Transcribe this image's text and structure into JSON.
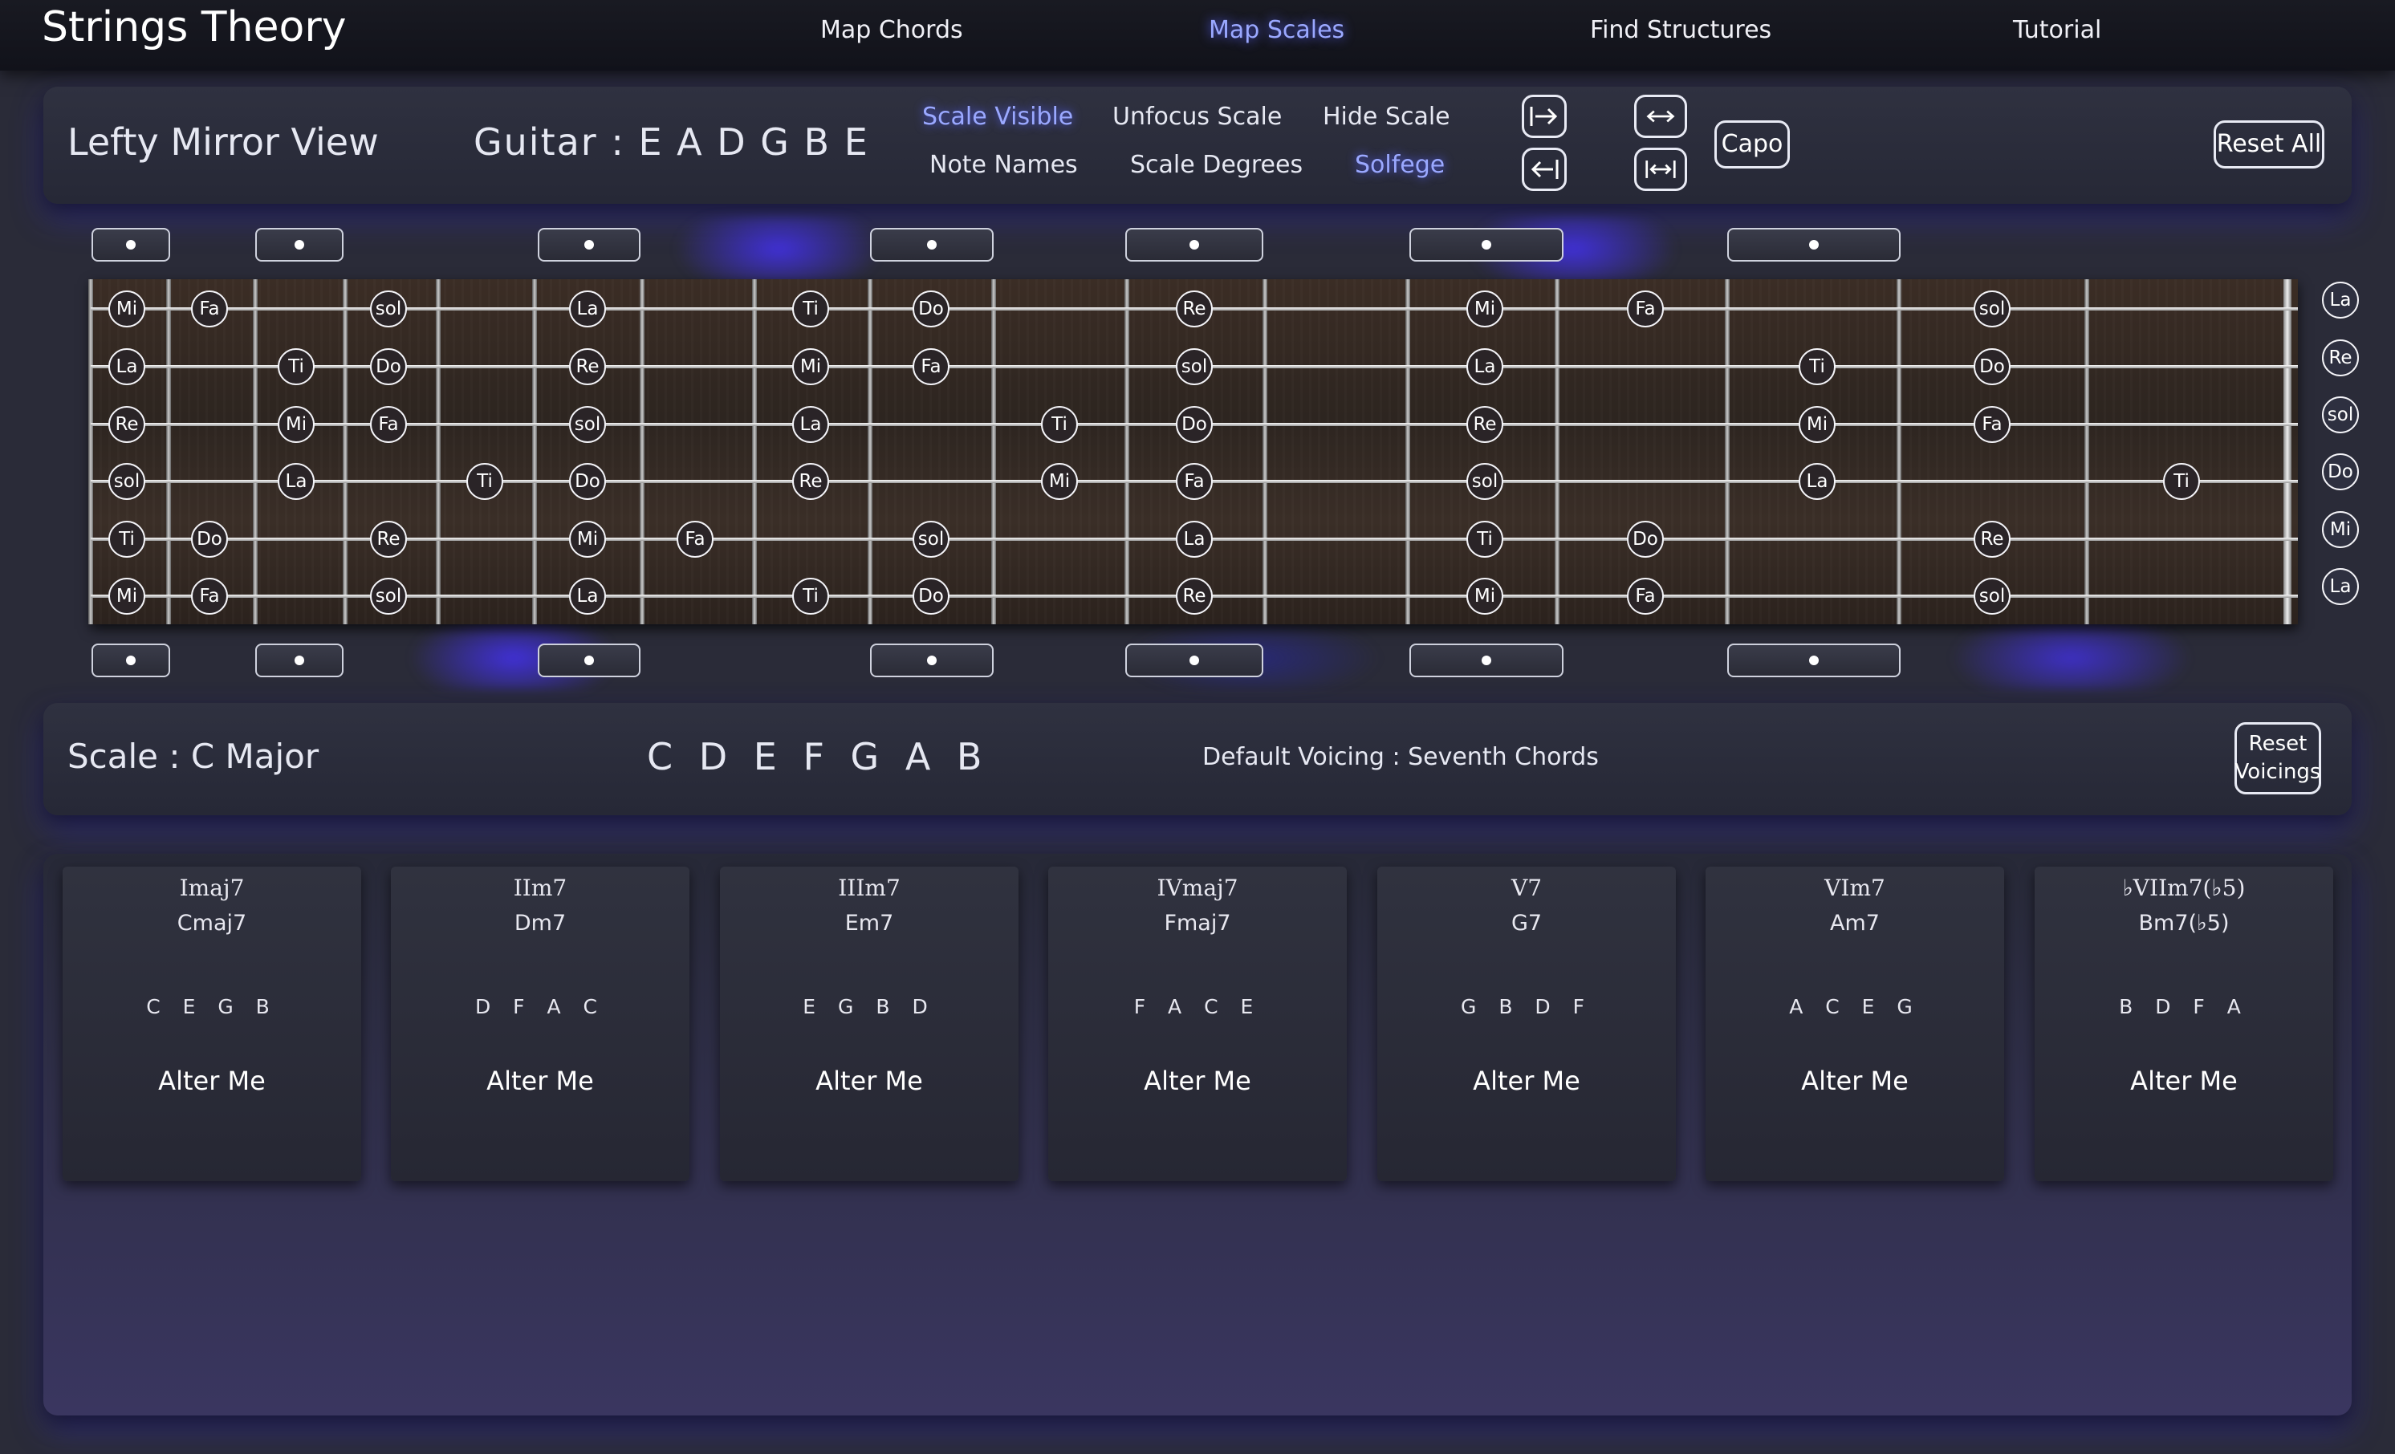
{
  "header": {
    "app_title": "Strings Theory",
    "nav": [
      "Map Chords",
      "Map Scales",
      "Find Structures",
      "Tutorial"
    ],
    "active_nav": "Map Scales"
  },
  "controls": {
    "view_label": "Lefty Mirror View",
    "tuning_label": "Guitar : E A D G B E",
    "scale_visible": "Scale Visible",
    "unfocus_scale": "Unfocus Scale",
    "hide_scale": "Hide Scale",
    "note_names": "Note Names",
    "scale_degrees": "Scale Degrees",
    "solfege": "Solfege",
    "capo": "Capo",
    "reset_all": "Reset All"
  },
  "fretboard": {
    "open_strings": [
      "La",
      "Re",
      "sol",
      "Do",
      "Mi",
      "La"
    ],
    "strings": [
      [
        "Mi",
        "Fa",
        "",
        "sol",
        "",
        "La",
        "",
        "Ti",
        "Do",
        "",
        "Re",
        "",
        "Mi",
        "Fa",
        "",
        "sol",
        "",
        ""
      ],
      [
        "La",
        "",
        "Ti",
        "Do",
        "",
        "Re",
        "",
        "Mi",
        "Fa",
        "",
        "sol",
        "",
        "La",
        "",
        "Ti",
        "Do",
        "",
        ""
      ],
      [
        "Re",
        "",
        "Mi",
        "Fa",
        "",
        "sol",
        "",
        "La",
        "",
        "Ti",
        "Do",
        "",
        "Re",
        "",
        "Mi",
        "Fa",
        "",
        ""
      ],
      [
        "sol",
        "",
        "La",
        "",
        "Ti",
        "Do",
        "",
        "Re",
        "",
        "Mi",
        "Fa",
        "",
        "sol",
        "",
        "La",
        "",
        "Ti",
        ""
      ],
      [
        "Ti",
        "Do",
        "",
        "Re",
        "",
        "Mi",
        "Fa",
        "",
        "sol",
        "",
        "La",
        "",
        "Ti",
        "Do",
        "",
        "Re",
        "",
        ""
      ],
      [
        "Mi",
        "Fa",
        "",
        "sol",
        "",
        "La",
        "",
        "Ti",
        "Do",
        "",
        "Re",
        "",
        "Mi",
        "Fa",
        "",
        "sol",
        "",
        ""
      ]
    ]
  },
  "scale": {
    "label": "Scale : C Major",
    "notes": "C D E F G A B",
    "voicing": "Default Voicing : Seventh Chords",
    "reset_voicings": [
      "Reset",
      "Voicings"
    ]
  },
  "chords": [
    {
      "roman": "Imaj7",
      "name": "Cmaj7",
      "notes": "C E G B",
      "action": "Alter Me"
    },
    {
      "roman": "IIm7",
      "name": "Dm7",
      "notes": "D F A C",
      "action": "Alter Me"
    },
    {
      "roman": "IIIm7",
      "name": "Em7",
      "notes": "E G B D",
      "action": "Alter Me"
    },
    {
      "roman": "IVmaj7",
      "name": "Fmaj7",
      "notes": "F A C E",
      "action": "Alter Me"
    },
    {
      "roman": "V7",
      "name": "G7",
      "notes": "G B D F",
      "action": "Alter Me"
    },
    {
      "roman": "VIm7",
      "name": "Am7",
      "notes": "A C E G",
      "action": "Alter Me"
    },
    {
      "roman": "♭VIIm7(♭5)",
      "name": "Bm7(♭5)",
      "notes": "B D F A",
      "action": "Alter Me"
    }
  ]
}
